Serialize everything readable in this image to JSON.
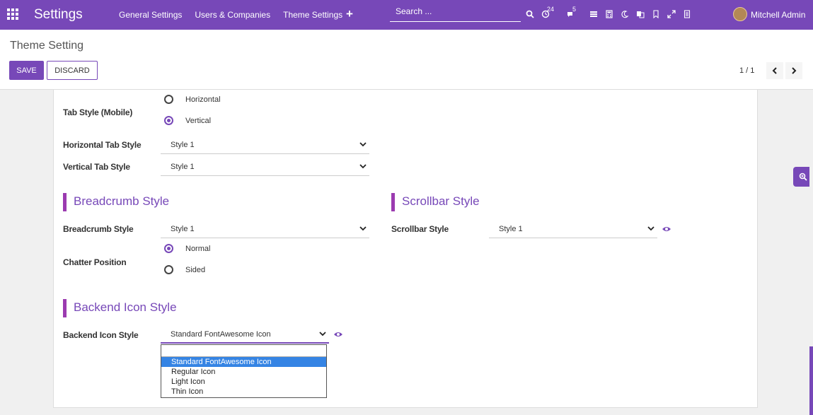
{
  "navbar": {
    "app_title": "Settings",
    "menu": [
      "General Settings",
      "Users & Companies",
      "Theme Settings"
    ],
    "plus": "+",
    "search_placeholder": "Search ...",
    "activity_count": "24",
    "message_count": "5",
    "user_name": "Mitchell Admin",
    "accent_color": "#7748b8"
  },
  "control_panel": {
    "breadcrumb": "Theme Setting",
    "save_label": "SAVE",
    "discard_label": "DISCARD",
    "pager": "1 / 1"
  },
  "form": {
    "tab_style_mobile": {
      "label": "Tab Style (Mobile)",
      "options": [
        "Horizontal",
        "Vertical"
      ],
      "selected": "Vertical"
    },
    "horizontal_tab_style": {
      "label": "Horizontal Tab Style",
      "value": "Style 1"
    },
    "vertical_tab_style": {
      "label": "Vertical Tab Style",
      "value": "Style 1"
    },
    "breadcrumb_section": {
      "title": "Breadcrumb Style",
      "field_label": "Breadcrumb Style",
      "value": "Style 1"
    },
    "scrollbar_section": {
      "title": "Scrollbar Style",
      "field_label": "Scrollbar Style",
      "value": "Style 1"
    },
    "chatter_position": {
      "label": "Chatter Position",
      "options": [
        "Normal",
        "Sided"
      ],
      "selected": "Normal"
    },
    "backend_icon_section": {
      "title": "Backend Icon Style",
      "field_label": "Backend Icon Style",
      "value": "Standard FontAwesome Icon",
      "dropdown_options": [
        "Standard FontAwesome Icon",
        "Regular Icon",
        "Light Icon",
        "Thin Icon"
      ],
      "highlighted_option": "Standard FontAwesome Icon"
    }
  }
}
